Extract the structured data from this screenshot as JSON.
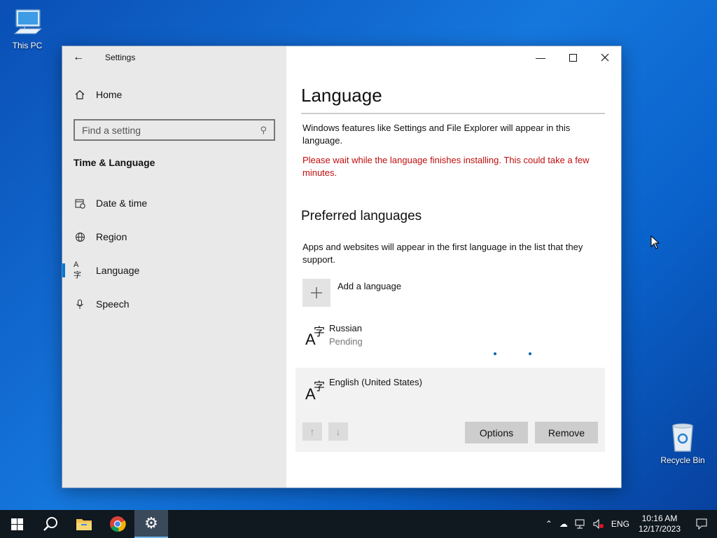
{
  "desktop": {
    "icons": [
      {
        "label": "This PC",
        "icon": "computer-icon"
      },
      {
        "label": "Recycle Bin",
        "icon": "recycle-bin-icon"
      }
    ]
  },
  "window": {
    "title": "Settings",
    "controls": {
      "minimize": "minimize-icon",
      "maximize": "maximize-icon",
      "close": "close-icon"
    }
  },
  "sidebar": {
    "home_label": "Home",
    "search_placeholder": "Find a setting",
    "section": "Time & Language",
    "items": [
      {
        "label": "Date & time",
        "icon": "calendar-clock-icon",
        "active": false
      },
      {
        "label": "Region",
        "icon": "globe-icon",
        "active": false
      },
      {
        "label": "Language",
        "icon": "language-icon",
        "active": true
      },
      {
        "label": "Speech",
        "icon": "microphone-icon",
        "active": false
      }
    ]
  },
  "main": {
    "title": "Language",
    "description": "Windows features like Settings and File Explorer will appear in this language.",
    "warning": "Please wait while the language finishes installing. This could take a few minutes.",
    "warning_color": "#c00e0e",
    "preferred_title": "Preferred languages",
    "preferred_description": "Apps and websites will appear in the first language in the list that they support.",
    "add_language": "Add a language",
    "languages": [
      {
        "name": "Russian",
        "status": "Pending",
        "icon": "language-icon"
      },
      {
        "name": "English (United States)",
        "status": "",
        "icon": "language-icon",
        "selected": true
      }
    ],
    "options_button": "Options",
    "remove_button": "Remove"
  },
  "taskbar": {
    "apps": [
      "windows-start-icon",
      "search-icon",
      "file-explorer-icon",
      "chrome-icon",
      "settings-icon"
    ],
    "tray": {
      "language": "ENG",
      "time": "10:16 AM",
      "date": "12/17/2023"
    }
  },
  "colors": {
    "accent": "#0078d7",
    "sidebar_bg": "#e9e9e9",
    "taskbar_bg": "#101820"
  }
}
